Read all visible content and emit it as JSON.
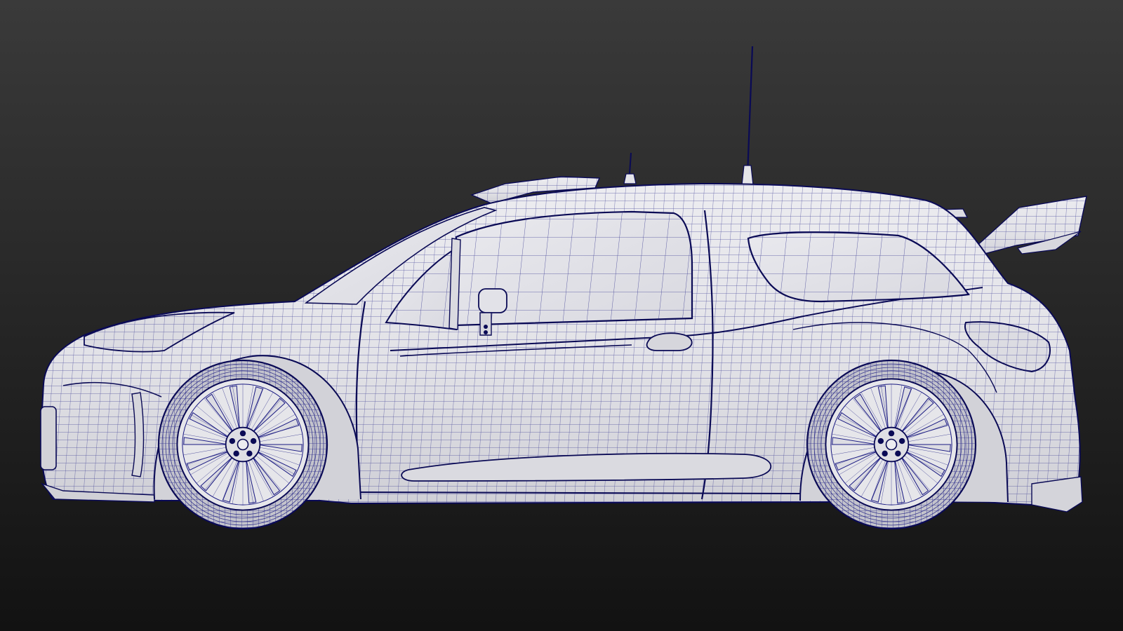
{
  "viewport": {
    "background_top": "#3a3a3a",
    "background_bottom": "#121212"
  },
  "model": {
    "subject": "rally-hatchback-car",
    "view": "side-left",
    "shading": "wireframe-on-shaded",
    "surface_color": "#e4e4e8",
    "surface_shadow": "#c9c9d0",
    "wire_color": "#1a1a82",
    "edge_color": "#0a0a55"
  }
}
